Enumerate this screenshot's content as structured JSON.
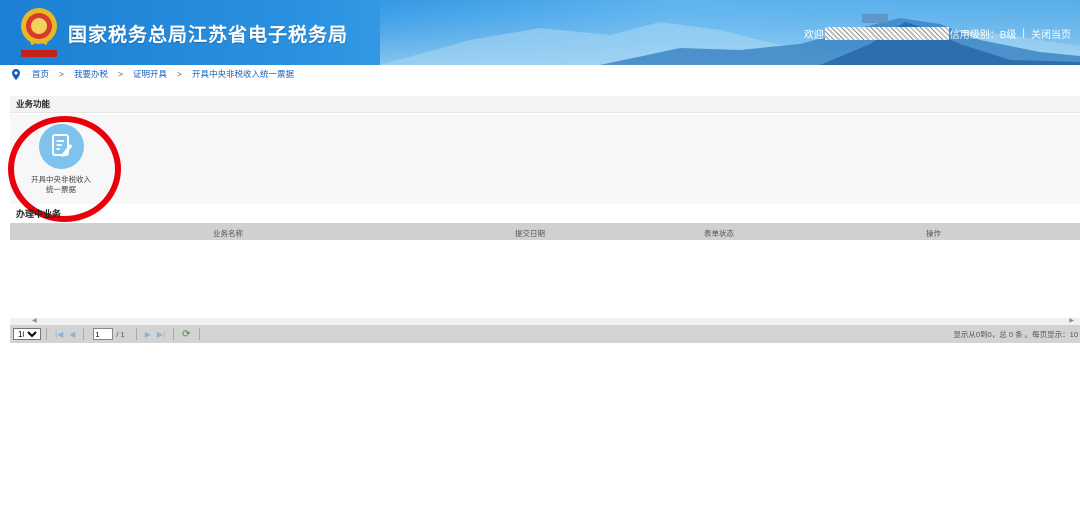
{
  "header": {
    "site_title": "国家税务总局江苏省电子税务局",
    "welcome": "欢迎",
    "credit_level": "信用级别：B级",
    "separator": "|",
    "close_page": "关闭当页",
    "colors": {
      "primary": "#1c7fd3",
      "light": "#5fb3ee"
    }
  },
  "breadcrumb": {
    "icon": "location-pin-icon",
    "items": [
      "首页",
      "我要办税",
      "证明开具",
      "开具中央非税收入统一票据"
    ],
    "arrow": ">"
  },
  "functions": {
    "section_title": "业务功能",
    "tiles": [
      {
        "label": "开具中央非税收入统一票据",
        "icon": "edit-document-icon"
      }
    ],
    "highlight_color": "#e8000b"
  },
  "grid": {
    "section_title": "办理中业务",
    "columns": [
      "业务名称",
      "提交日期",
      "表单状态",
      "操作"
    ],
    "rows": []
  },
  "pager": {
    "page_size": "10",
    "page_size_options": [
      "10"
    ],
    "current_page": "1",
    "total_pages": "/ 1",
    "info": "显示从0到0，总 0 条 。每页显示：10"
  },
  "scroll": {
    "left": "◀",
    "right": "▶"
  }
}
